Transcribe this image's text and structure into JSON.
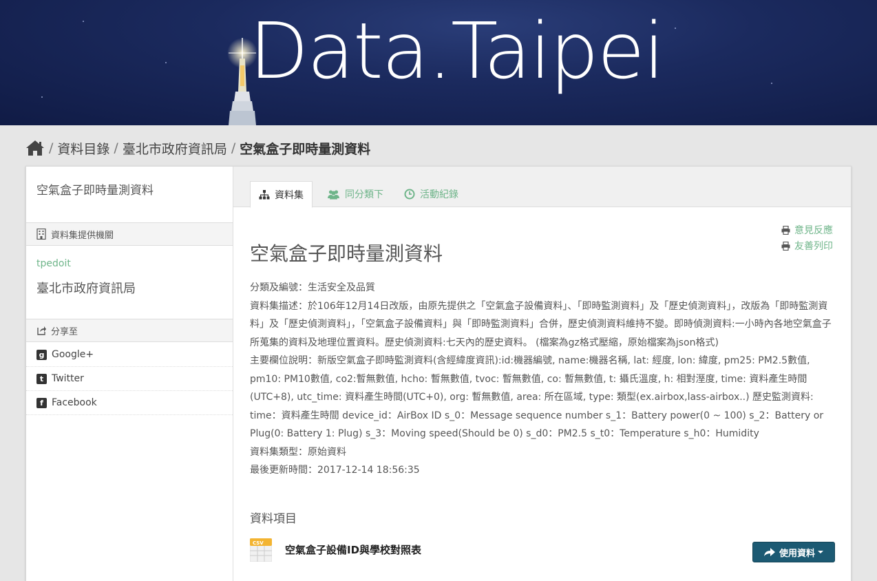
{
  "banner": {
    "title": "Data.Taipei"
  },
  "breadcrumb": {
    "items": [
      "資料目錄",
      "臺北市政府資訊局"
    ],
    "current": "空氣盒子即時量測資料"
  },
  "sidebar": {
    "title": "空氣盒子即時量測資料",
    "provider_heading": "資料集提供機關",
    "provider_id": "tpedoit",
    "provider_name": "臺北市政府資訊局",
    "share_heading": "分享至",
    "share_items": [
      {
        "label": "Google+",
        "icon": "google-plus-icon"
      },
      {
        "label": "Twitter",
        "icon": "twitter-icon"
      },
      {
        "label": "Facebook",
        "icon": "facebook-icon"
      }
    ]
  },
  "tabs": [
    {
      "label": "資料集",
      "icon": "sitemap-icon",
      "active": true
    },
    {
      "label": "同分類下",
      "icon": "group-icon",
      "active": false
    },
    {
      "label": "活動紀錄",
      "icon": "clock-icon",
      "active": false
    }
  ],
  "utility": {
    "feedback": "意見反應",
    "print": "友善列印"
  },
  "dataset": {
    "title": "空氣盒子即時量測資料",
    "category": "分類及編號：生活安全及品質",
    "description": "資料集描述：於106年12月14日改版，由原先提供之「空氣盒子設備資料」、「即時監測資料」及「歷史偵測資料」，改版為「即時監測資料」及「歷史偵測資料」，「空氣盒子設備資料」與「即時監測資料」合併，歷史偵測資料維持不變。即時偵測資料:一小時內各地空氣盒子所蒐集的資料及地理位置資料。歷史偵測資料:七天內的歷史資料。 (檔案為gz格式壓縮，原始檔案為json格式)",
    "fields": "主要欄位說明：新版空氣盒子即時監測資料(含經緯度資訊):id:機器編號, name:機器名稱, lat: 經度, lon: 緯度, pm25: PM2.5數值, pm10: PM10數值, co2:暫無數值, hcho: 暫無數值, tvoc: 暫無數值, co: 暫無數值, t: 攝氏溫度, h: 相對溼度, time: 資料產生時間(UTC+8), utc_time: 資料產生時間(UTC+0), org: 暫無數值, area: 所在區域, type: 類型(ex.airbox,lass-airbox..) 歷史監測資料: time：資料產生時間 device_id：AirBox ID s_0：Message sequence number s_1：Battery power(0 ~ 100) s_2：Battery or Plug(0: Battery 1: Plug) s_3：Moving speed(Should be 0) s_d0：PM2.5 s_t0：Temperature s_h0：Humidity",
    "type": "資料集類型：原始資料",
    "updated": "最後更新時間：2017-12-14 18:56:35"
  },
  "resources": {
    "heading": "資料項目",
    "items": [
      {
        "name": "空氣盒子設備ID與學校對照表",
        "format": "CSV",
        "button": "使用資料"
      }
    ]
  },
  "colors": {
    "accent": "#6fb58a",
    "button": "#1c5a73",
    "banner": "#1b2a5e"
  }
}
